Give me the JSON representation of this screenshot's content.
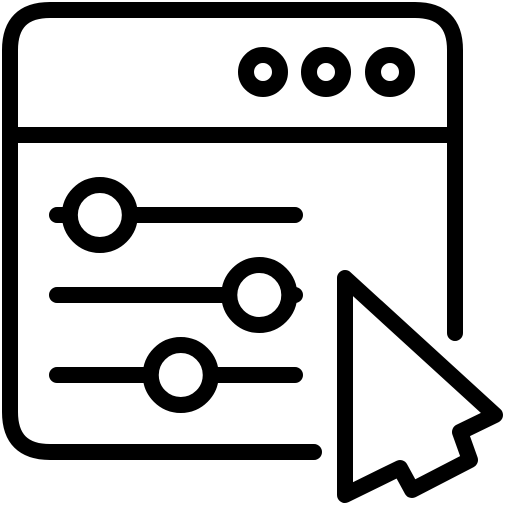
{
  "icon": {
    "name": "browser-settings-cursor-icon",
    "stroke_color": "#000000",
    "background_color": "#ffffff",
    "window": {
      "dots": [
        "window-dot",
        "window-dot",
        "window-dot"
      ]
    },
    "sliders": [
      {
        "name": "slider-1",
        "level": 0.18
      },
      {
        "name": "slider-2",
        "level": 0.85
      },
      {
        "name": "slider-3",
        "level": 0.52
      }
    ],
    "cursor": {
      "name": "cursor-arrow-icon"
    }
  }
}
